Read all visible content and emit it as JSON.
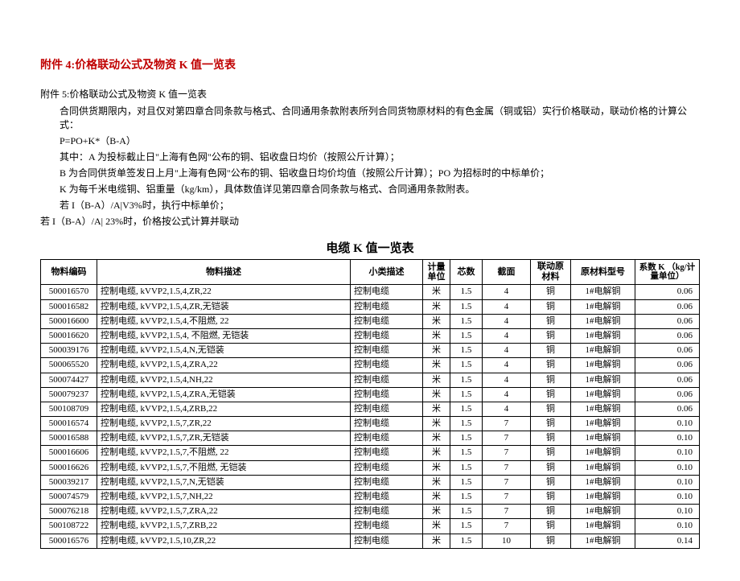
{
  "title_main": "附件 4:价格联动公式及物资 K 值一览表",
  "subtitle": "附件 5:价格联动公式及物资 K 值一览表",
  "intro": {
    "line1": "合同供货期限内，对且仅对第四章合同条款与格式、合同通用条款附表所列合同货物原材料的有色金属（铜或铝）实行价格联动，联动价格的计算公式：",
    "line2": "P=PO+K*（B-A）",
    "line3": "其中：A 为投标截止日\"上海有色网\"公布的铜、铝收盘日均价（按照公斤计算）；",
    "line4": "B 为合同供货单签发日上月\"上海有色网\"公布的铜、铝收盘日均价均值（按照公斤计算）；PO 为招标时的中标单价；",
    "line5": "K 为每千米电缆铜、铝重量（kg/km），具体数值详见第四章合同条款与格式、合同通用条款附表。",
    "line6": "若 I（B-A）/A|V3%时，执行中标单价；",
    "line7": "若 I（B-A）/A| 23%时，价格按公式计算并联动"
  },
  "table_title": "电缆 K 值一览表",
  "headers": {
    "code": "物料编码",
    "desc": "物料描述",
    "subdesc": "小类描述",
    "unit": "计量单位",
    "core": "芯数",
    "section": "截面",
    "mat": "联动原材料",
    "model": "原材料型号",
    "k": "系数 K （kg/计量单位）"
  },
  "rows": [
    {
      "code": "500016570",
      "desc": "控制电缆, kVVP2,1.5,4,ZR,22",
      "sub": "控制电缆",
      "unit": "米",
      "core": "1.5",
      "section": "4",
      "mat": "铜",
      "model": "1#电解铜",
      "k": "0.06"
    },
    {
      "code": "500016582",
      "desc": "控制电缆, kVVP2,1.5,4,ZR,无铠装",
      "sub": "控制电缆",
      "unit": "米",
      "core": "1.5",
      "section": "4",
      "mat": "铜",
      "model": "1#电解铜",
      "k": "0.06"
    },
    {
      "code": "500016600",
      "desc": "控制电缆, kVVP2,1.5,4,不阻燃, 22",
      "sub": "控制电缆",
      "unit": "米",
      "core": "1.5",
      "section": "4",
      "mat": "铜",
      "model": "1#电解铜",
      "k": "0.06"
    },
    {
      "code": "500016620",
      "desc": "控制电缆, kVVP2,1.5,4, 不阻燃, 无铠装",
      "sub": "控制电缆",
      "unit": "米",
      "core": "1.5",
      "section": "4",
      "mat": "铜",
      "model": "1#电解铜",
      "k": "0.06"
    },
    {
      "code": "500039176",
      "desc": "控制电缆, kVVP2,1.5,4,N,无铠装",
      "sub": "控制电缆",
      "unit": "米",
      "core": "1.5",
      "section": "4",
      "mat": "铜",
      "model": "1#电解铜",
      "k": "0.06"
    },
    {
      "code": "500065520",
      "desc": "控制电缆, kVVP2,1.5,4,ZRA,22",
      "sub": "控制电缆",
      "unit": "米",
      "core": "1.5",
      "section": "4",
      "mat": "铜",
      "model": "1#电解铜",
      "k": "0.06"
    },
    {
      "code": "500074427",
      "desc": "控制电缆, kVVP2,1.5,4,NH,22",
      "sub": "控制电缆",
      "unit": "米",
      "core": "1.5",
      "section": "4",
      "mat": "铜",
      "model": "1#电解铜",
      "k": "0.06"
    },
    {
      "code": "500079237",
      "desc": "控制电缆, kVVP2,1.5,4,ZRA,无铠装",
      "sub": "控制电缆",
      "unit": "米",
      "core": "1.5",
      "section": "4",
      "mat": "铜",
      "model": "1#电解铜",
      "k": "0.06"
    },
    {
      "code": "500108709",
      "desc": "控制电缆, kVVP2,1.5,4,ZRB,22",
      "sub": "控制电缆",
      "unit": "米",
      "core": "1.5",
      "section": "4",
      "mat": "铜",
      "model": "1#电解铜",
      "k": "0.06"
    },
    {
      "code": "500016574",
      "desc": "控制电缆, kVVP2,1.5,7,ZR,22",
      "sub": "控制电缆",
      "unit": "米",
      "core": "1.5",
      "section": "7",
      "mat": "铜",
      "model": "1#电解铜",
      "k": "0.10"
    },
    {
      "code": "500016588",
      "desc": "控制电缆, kVVP2,1.5,7,ZR,无铠装",
      "sub": "控制电缆",
      "unit": "米",
      "core": "1.5",
      "section": "7",
      "mat": "铜",
      "model": "1#电解铜",
      "k": "0.10"
    },
    {
      "code": "500016606",
      "desc": "控制电缆, kVVP2,1.5,7,不阻燃, 22",
      "sub": "控制电缆",
      "unit": "米",
      "core": "1.5",
      "section": "7",
      "mat": "铜",
      "model": "1#电解铜",
      "k": "0.10"
    },
    {
      "code": "500016626",
      "desc": "控制电缆, kVVP2,1.5,7,不阻燃, 无铠装",
      "sub": "控制电缆",
      "unit": "米",
      "core": "1.5",
      "section": "7",
      "mat": "铜",
      "model": "1#电解铜",
      "k": "0.10"
    },
    {
      "code": "500039217",
      "desc": "控制电缆, kVVP2,1.5,7,N,无铠装",
      "sub": "控制电缆",
      "unit": "米",
      "core": "1.5",
      "section": "7",
      "mat": "铜",
      "model": "1#电解铜",
      "k": "0.10"
    },
    {
      "code": "500074579",
      "desc": "控制电缆, kVVP2,1.5,7,NH,22",
      "sub": "控制电缆",
      "unit": "米",
      "core": "1.5",
      "section": "7",
      "mat": "铜",
      "model": "1#电解铜",
      "k": "0.10"
    },
    {
      "code": "500076218",
      "desc": "控制电缆, kVVP2,1.5,7,ZRA,22",
      "sub": "控制电缆",
      "unit": "米",
      "core": "1.5",
      "section": "7",
      "mat": "铜",
      "model": "1#电解铜",
      "k": "0.10"
    },
    {
      "code": "500108722",
      "desc": "控制电缆, kVVP2,1.5,7,ZRB,22",
      "sub": "控制电缆",
      "unit": "米",
      "core": "1.5",
      "section": "7",
      "mat": "铜",
      "model": "1#电解铜",
      "k": "0.10"
    },
    {
      "code": "500016576",
      "desc": "控制电缆, kVVP2,1.5,10,ZR,22",
      "sub": "控制电缆",
      "unit": "米",
      "core": "1.5",
      "section": "10",
      "mat": "铜",
      "model": "1#电解铜",
      "k": "0.14"
    }
  ]
}
